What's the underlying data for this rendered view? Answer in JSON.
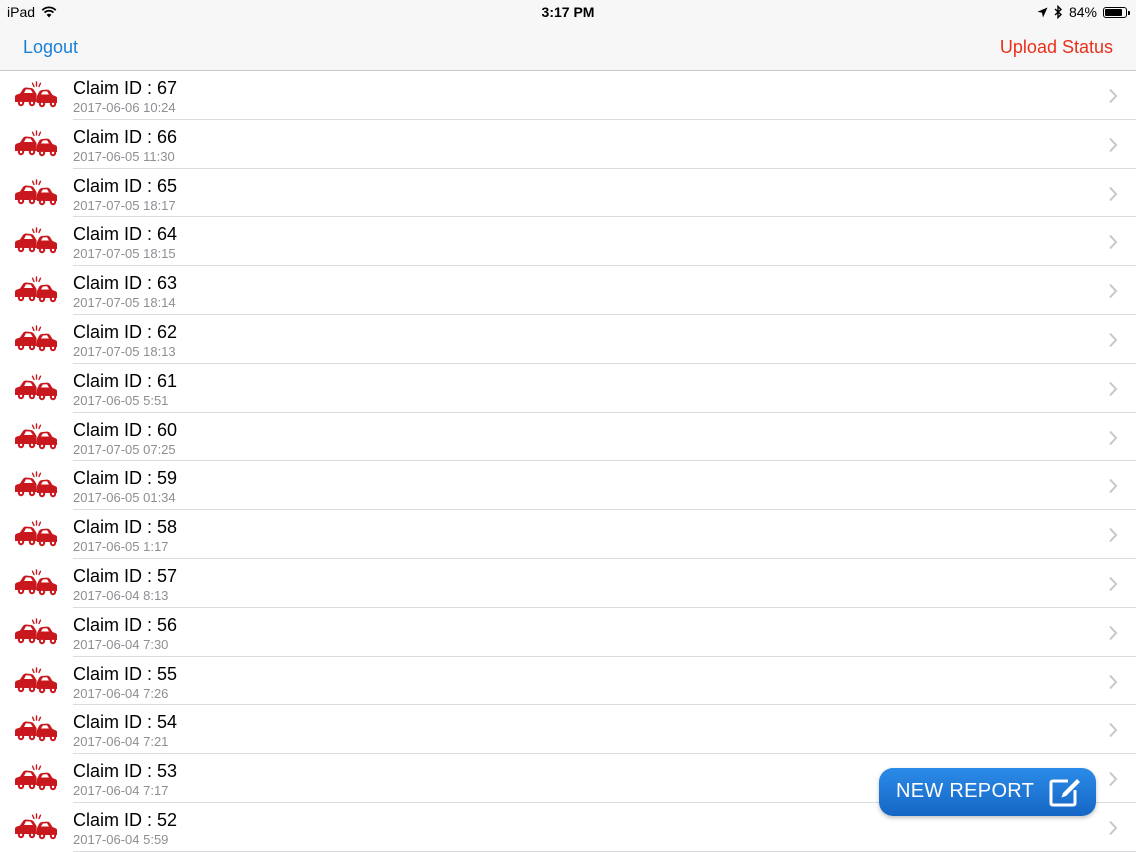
{
  "status_bar": {
    "device": "iPad",
    "time": "3:17 PM",
    "battery": "84%",
    "battery_level": 0.84,
    "icons": [
      "wifi-icon",
      "location-arrow-icon",
      "bluetooth-icon",
      "battery-icon"
    ]
  },
  "nav": {
    "logout_label": "Logout",
    "upload_status_label": "Upload Status"
  },
  "colors": {
    "link_blue": "#1a7fd4",
    "accent_red": "#e8301c",
    "car_red": "#c8181e",
    "button_blue": "#1f74d6"
  },
  "claims": [
    {
      "title": "Claim ID : 67",
      "date": "2017-06-06 10:24"
    },
    {
      "title": "Claim ID : 66",
      "date": "2017-06-05 11:30"
    },
    {
      "title": "Claim ID : 65",
      "date": "2017-07-05 18:17"
    },
    {
      "title": "Claim ID : 64",
      "date": "2017-07-05 18:15"
    },
    {
      "title": "Claim ID : 63",
      "date": "2017-07-05 18:14"
    },
    {
      "title": "Claim ID : 62",
      "date": "2017-07-05 18:13"
    },
    {
      "title": "Claim ID : 61",
      "date": "2017-06-05 5:51"
    },
    {
      "title": "Claim ID : 60",
      "date": "2017-07-05 07:25"
    },
    {
      "title": "Claim ID : 59",
      "date": "2017-06-05 01:34"
    },
    {
      "title": "Claim ID : 58",
      "date": "2017-06-05 1:17"
    },
    {
      "title": "Claim ID : 57",
      "date": "2017-06-04 8:13"
    },
    {
      "title": "Claim ID : 56",
      "date": "2017-06-04 7:30"
    },
    {
      "title": "Claim ID : 55",
      "date": "2017-06-04 7:26"
    },
    {
      "title": "Claim ID : 54",
      "date": "2017-06-04 7:21"
    },
    {
      "title": "Claim ID : 53",
      "date": "2017-06-04 7:17"
    },
    {
      "title": "Claim ID : 52",
      "date": "2017-06-04 5:59"
    }
  ],
  "row_icons": {
    "leading": "car-crash-icon",
    "trailing": "chevron-right-icon"
  },
  "new_report": {
    "label": "NEW REPORT",
    "icon": "edit-icon"
  }
}
